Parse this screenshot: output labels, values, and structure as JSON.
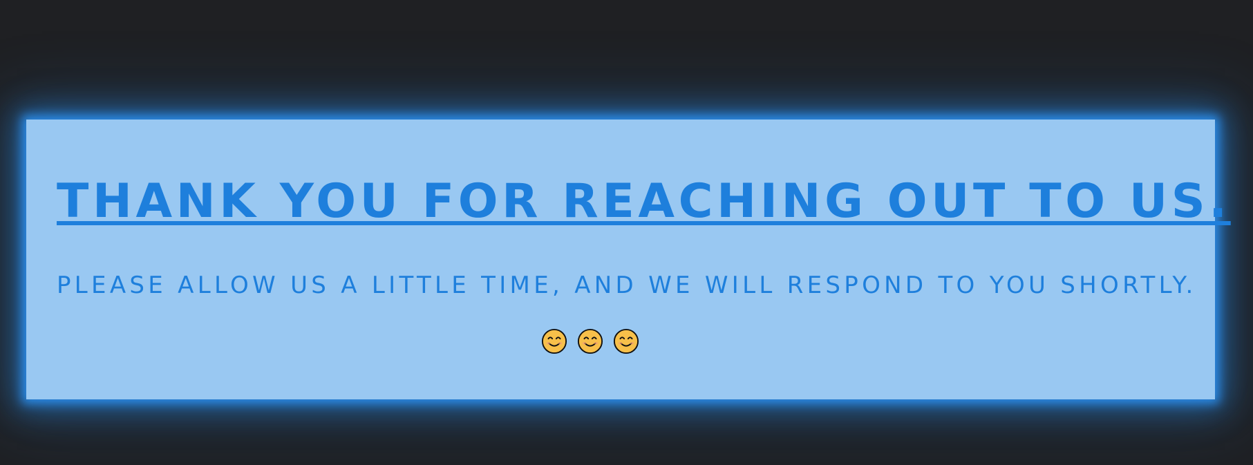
{
  "message": {
    "heading": "THANK YOU FOR REACHING OUT TO US.",
    "subheading": "PLEASE ALLOW US A LITTLE TIME, AND WE WILL RESPOND TO YOU SHORTLY."
  },
  "emojis": [
    {
      "icon": "smiling-face-icon"
    },
    {
      "icon": "smiling-face-icon"
    },
    {
      "icon": "smiling-face-icon"
    }
  ],
  "colors": {
    "background": "#1f2023",
    "card": "#99c8f2",
    "accent": "#1e7fdc",
    "glow": "#2a8ae6",
    "emoji": "#f7c04a"
  }
}
